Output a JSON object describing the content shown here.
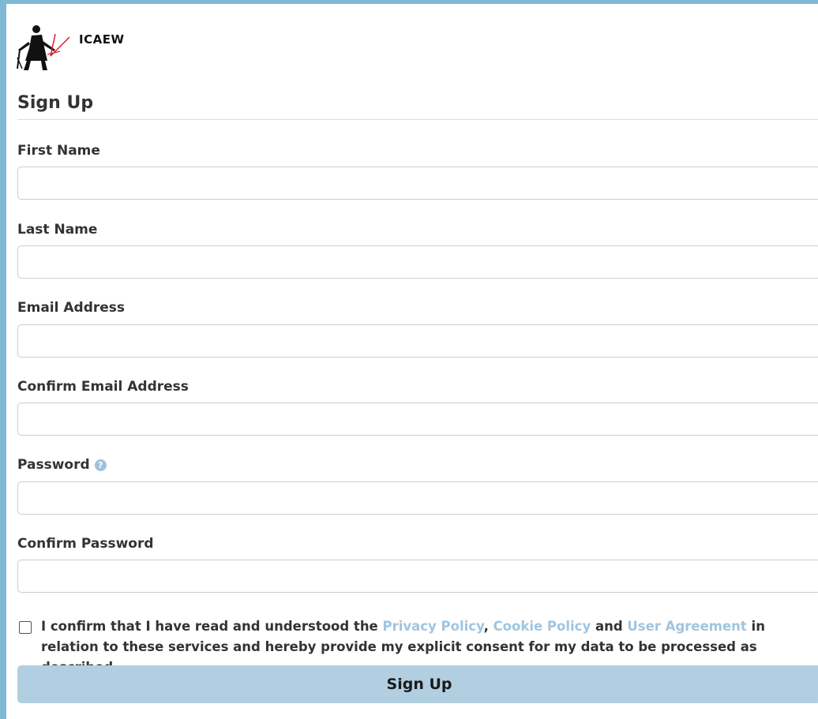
{
  "header": {
    "logo_icon": "figure-with-scales-logo-icon",
    "logo_text": "ICAEW"
  },
  "form": {
    "title": "Sign Up",
    "fields": [
      {
        "label": "First Name",
        "value": "",
        "placeholder": ""
      },
      {
        "label": "Last Name",
        "value": "",
        "placeholder": ""
      },
      {
        "label": "Email Address",
        "value": "",
        "placeholder": ""
      },
      {
        "label": "Confirm Email Address",
        "value": "",
        "placeholder": ""
      },
      {
        "label": "Password",
        "value": "",
        "placeholder": "",
        "help_icon": "question-circle-icon"
      },
      {
        "label": "Confirm Password",
        "value": "",
        "placeholder": ""
      }
    ],
    "consent": {
      "checked": false,
      "text_before": "I confirm that I have read and understood the ",
      "privacy_link": "Privacy Policy",
      "sep1": ", ",
      "cookie_link": "Cookie Policy",
      "sep2": " and ",
      "agreement_link": "User Agreement",
      "text_after": " in relation to these services and hereby provide my explicit consent for my data to be processed as described."
    },
    "submit_label": "Sign Up"
  },
  "colors": {
    "frame_border": "#7fb9d6",
    "link": "#9fc5e0",
    "button_bg": "#b1cfe0",
    "help_icon": "#9ec3dc"
  }
}
